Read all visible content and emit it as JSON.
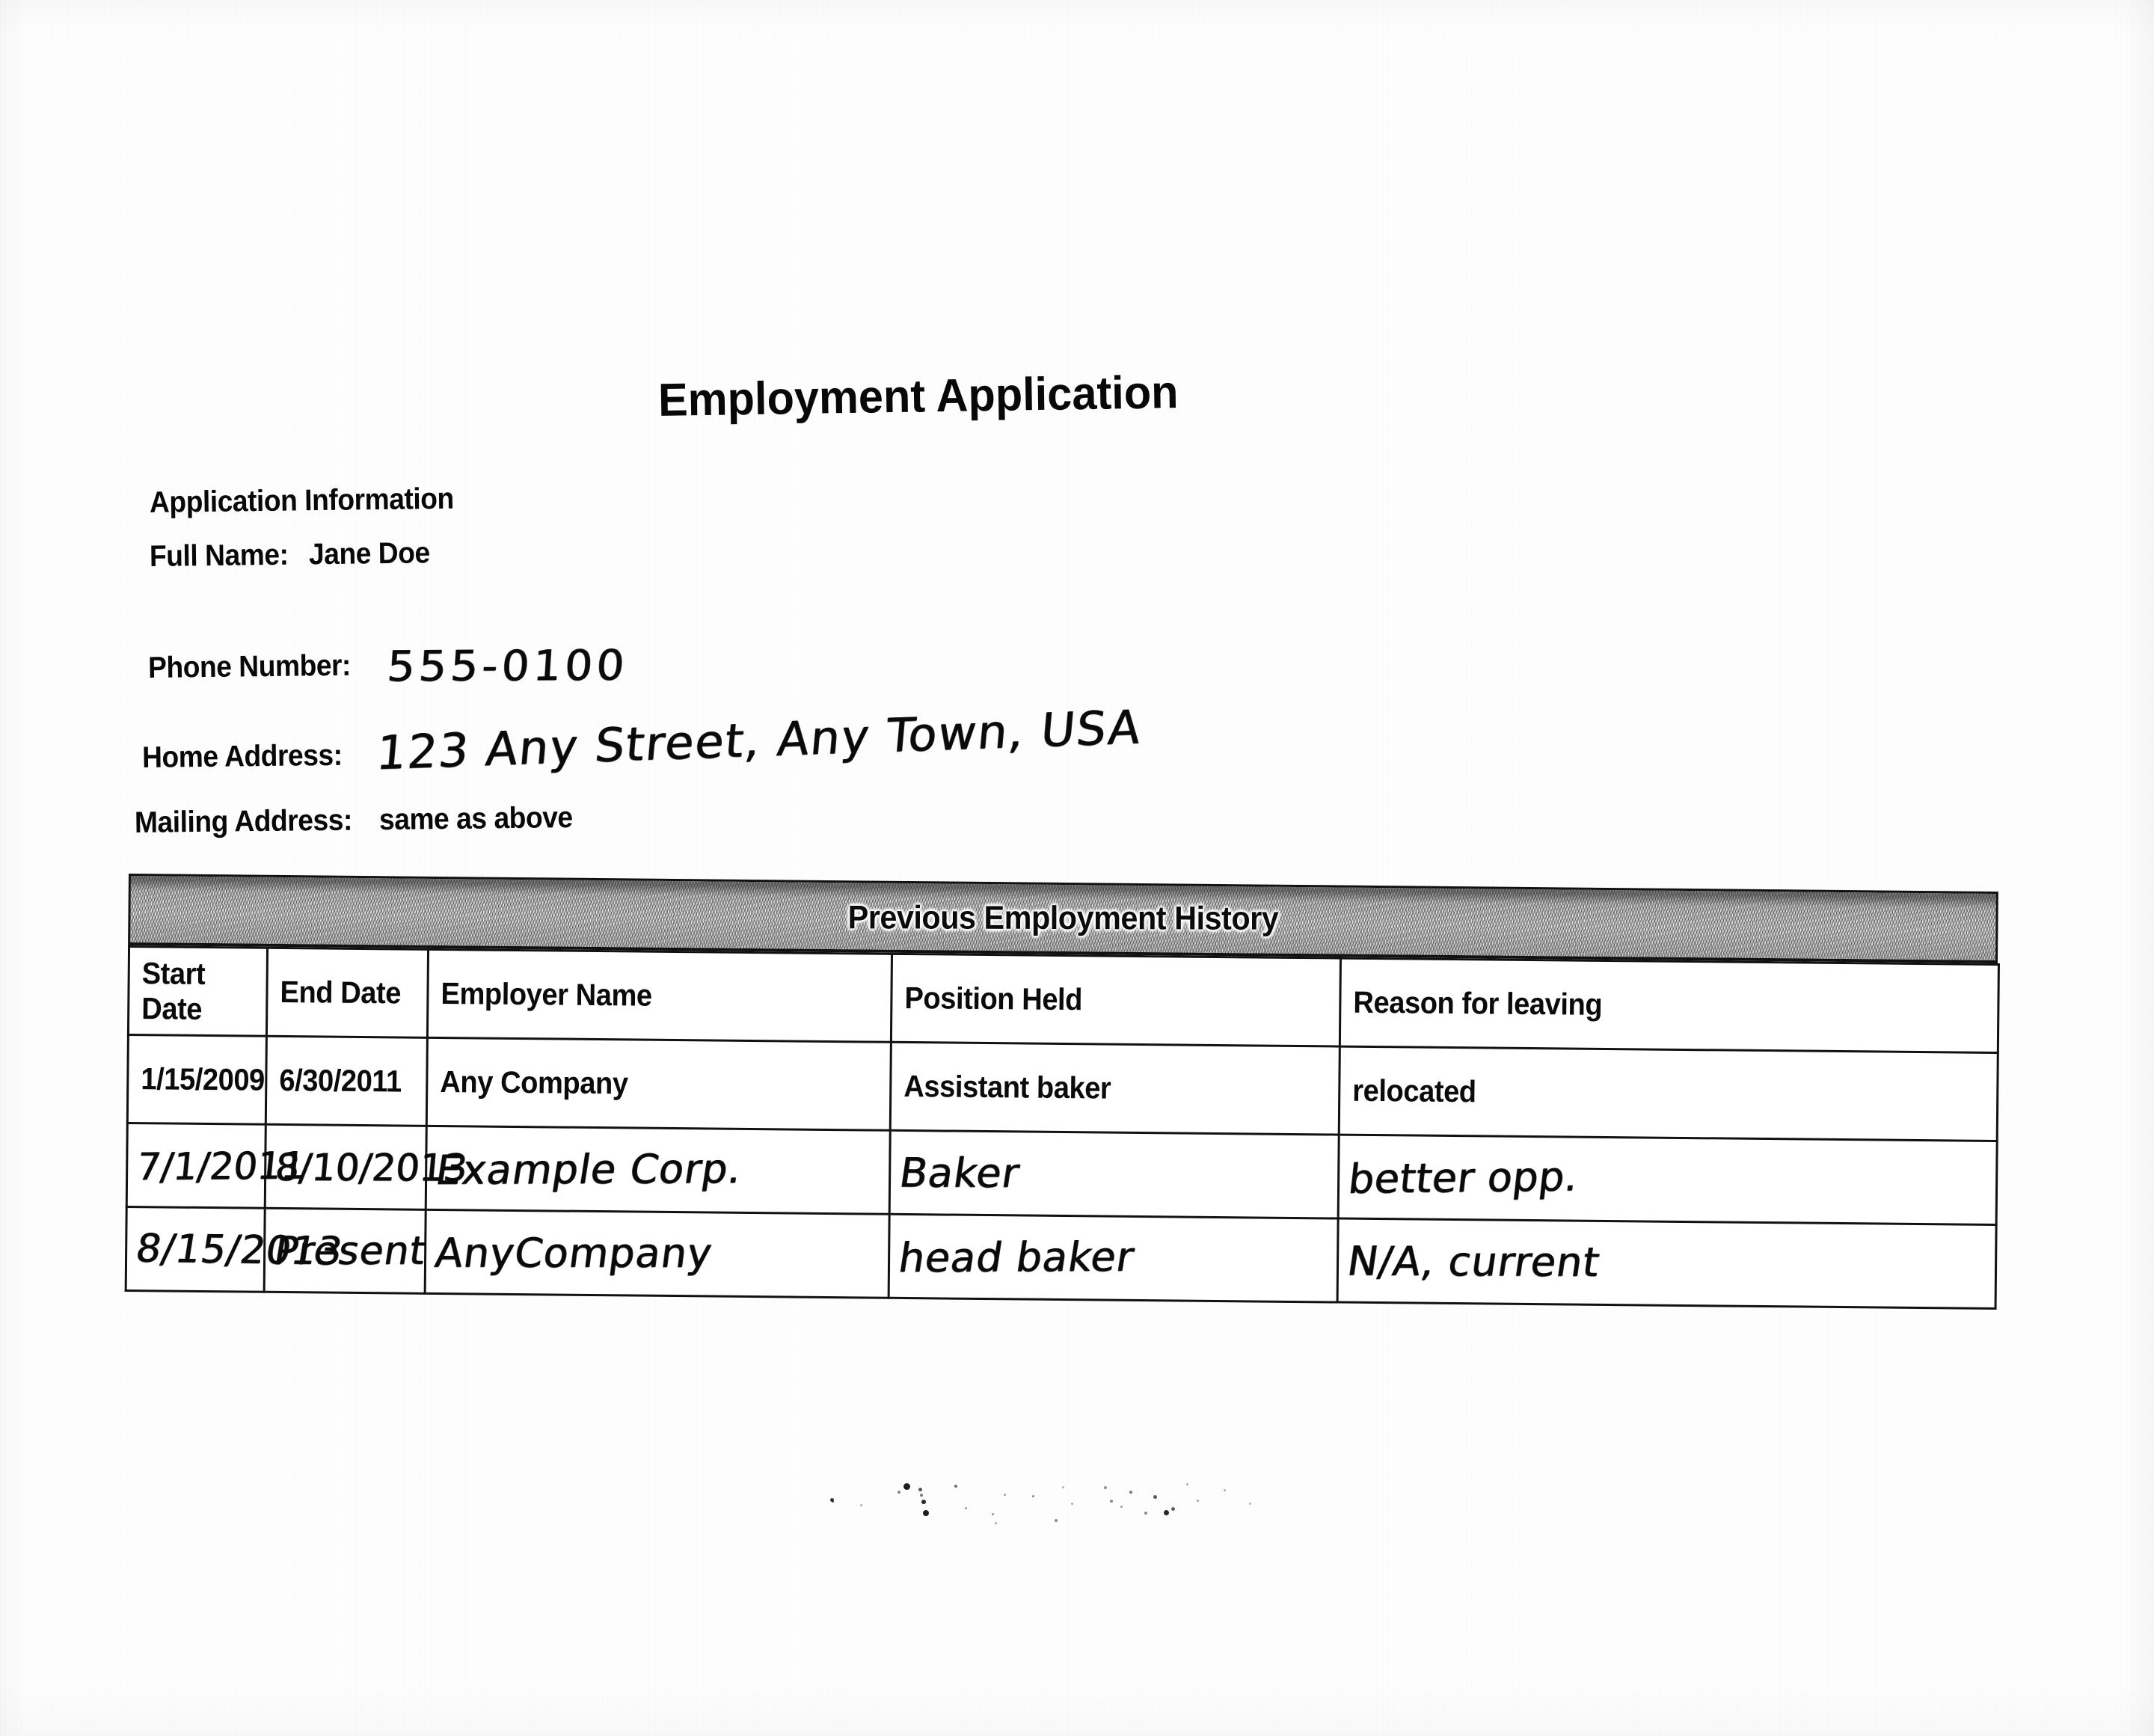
{
  "document": {
    "title": "Employment Application",
    "section_heading": "Application Information"
  },
  "application_information": {
    "full_name": {
      "label": "Full Name:",
      "value": "Jane Doe",
      "handwritten": false
    },
    "phone_number": {
      "label": "Phone Number:",
      "value": "555-0100",
      "handwritten": true
    },
    "home_address": {
      "label": "Home Address:",
      "value": "123 Any Street, Any Town, USA",
      "handwritten": true
    },
    "mailing_address": {
      "label": "Mailing Address:",
      "value": "same as above",
      "handwritten": false
    }
  },
  "employment_table": {
    "banner_title": "Previous Employment History",
    "columns": [
      "Start Date",
      "End Date",
      "Employer Name",
      "Position Held",
      "Reason for leaving"
    ],
    "rows": [
      {
        "handwritten": false,
        "start_date": "1/15/2009",
        "end_date": "6/30/2011",
        "employer_name": "Any Company",
        "position_held": "Assistant baker",
        "reason_for_leaving": "relocated"
      },
      {
        "handwritten": true,
        "start_date": "7/1/2011",
        "end_date": "8/10/2013",
        "employer_name": "Example Corp.",
        "position_held": "Baker",
        "reason_for_leaving": "better opp."
      },
      {
        "handwritten": true,
        "start_date": "8/15/2013",
        "end_date": "Present",
        "employer_name": "AnyCompany",
        "position_held": "head baker",
        "reason_for_leaving": "N/A, current"
      }
    ]
  },
  "colors": {
    "ink": "#0a0a0a",
    "paper": "#fdfdfd",
    "banner_gray": "#e9e9e9",
    "rule": "#111111"
  }
}
